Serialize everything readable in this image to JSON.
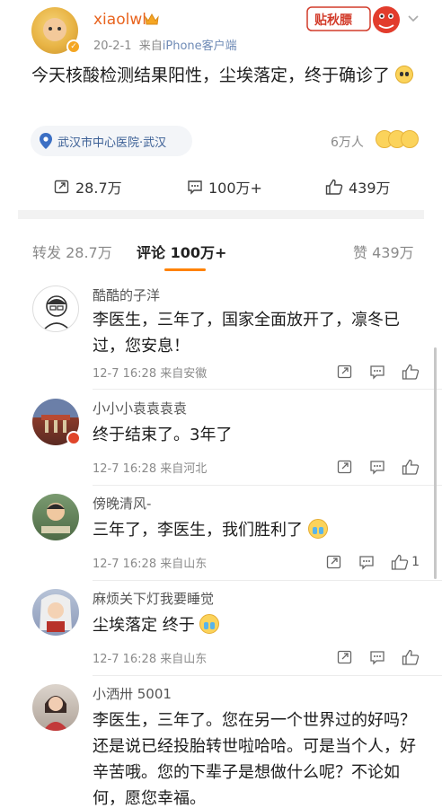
{
  "post": {
    "username": "xiaolwl",
    "date": "20-2-1",
    "source_prefix": "来自",
    "source": "iPhone客户端",
    "text": "今天核酸检测结果阳性，尘埃落定，终于确诊了",
    "location": "武汉市中心医院·武汉",
    "viewers": "6万人",
    "sticker_text": "贴秋膘"
  },
  "actions": {
    "repost": "28.7万",
    "comment": "100万+",
    "like": "439万"
  },
  "tabs": {
    "repost": "转发 28.7万",
    "comment": "评论 100万+",
    "like": "赞 439万"
  },
  "comments": [
    {
      "name": "酷酷的子洋",
      "text": "李医生，三年了，国家全面放开了，凛冬已过，您安息！",
      "time": "12-7 16:28",
      "loc": "来自安徽",
      "likes": ""
    },
    {
      "name": "小小小袁袁袁袁",
      "text": "终于结束了。3年了",
      "time": "12-7 16:28",
      "loc": "来自河北",
      "likes": ""
    },
    {
      "name": "傍晚清风-",
      "text": "三年了，李医生，我们胜利了",
      "time": "12-7 16:28",
      "loc": "来自山东",
      "likes": "1"
    },
    {
      "name": "麻烦关下灯我要睡觉",
      "text": "尘埃落定 终于",
      "time": "12-7 16:28",
      "loc": "来自山东",
      "likes": ""
    },
    {
      "name": "小洒卅 5001",
      "text": "李医生，三年了。您在另一个世界过的好吗？还是说已经投胎转世啦哈哈。可是当个人，好辛苦哦。您的下辈子是想做什么呢？不论如何，愿您幸福。",
      "time": "",
      "loc": "",
      "likes": ""
    }
  ],
  "colors": {
    "username": "#e8641f",
    "tab_underline": "#ff8200",
    "location_text": "#3b5f95"
  }
}
